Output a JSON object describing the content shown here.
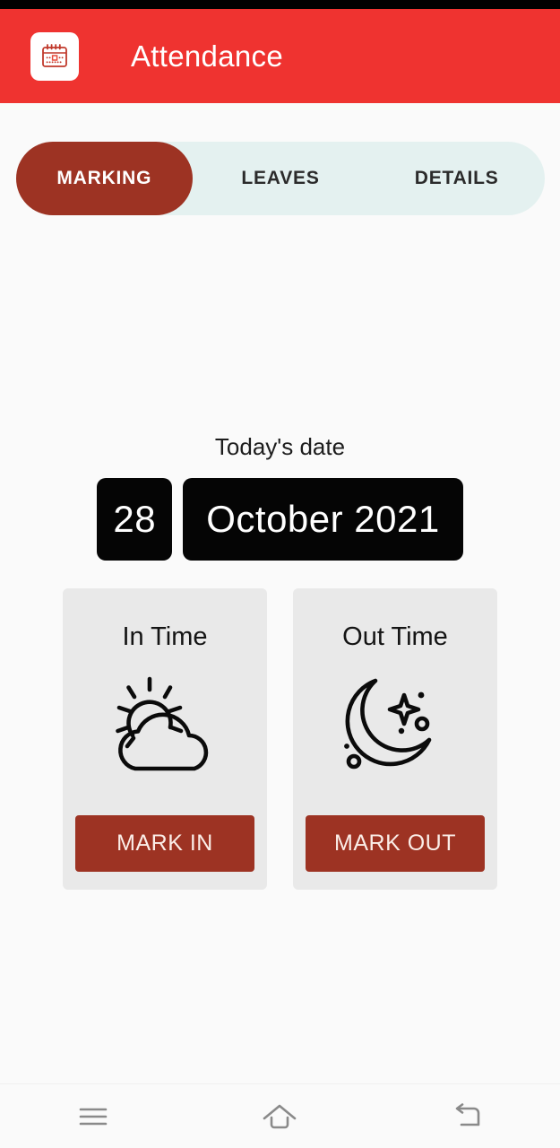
{
  "statusbar": {
    "present": true
  },
  "header": {
    "title": "Attendance",
    "icon": "calendar-icon",
    "background_color": "#ef3330",
    "title_color": "#ffffff"
  },
  "tabs": {
    "background_color": "#e4f1f0",
    "active_color": "#9d3323",
    "items": [
      {
        "label": "MARKING",
        "active": true
      },
      {
        "label": "LEAVES",
        "active": false
      },
      {
        "label": "DETAILS",
        "active": false
      }
    ]
  },
  "main": {
    "date_label": "Today's date",
    "date": {
      "day": "28",
      "month_year": "October 2021",
      "box_color": "#050505",
      "text_color": "#ffffff"
    },
    "cards": [
      {
        "title": "In Time",
        "icon": "sun-behind-cloud-icon",
        "button_label": "MARK IN",
        "button_color": "#9d3323",
        "card_color": "#e9e9e9"
      },
      {
        "title": "Out Time",
        "icon": "crescent-moon-stars-icon",
        "button_label": "MARK OUT",
        "button_color": "#9d3323",
        "card_color": "#e9e9e9"
      }
    ]
  },
  "navbar": {
    "items": [
      {
        "icon": "recents-menu-icon"
      },
      {
        "icon": "home-icon"
      },
      {
        "icon": "back-icon"
      }
    ],
    "icon_color": "#8a8a8a"
  }
}
